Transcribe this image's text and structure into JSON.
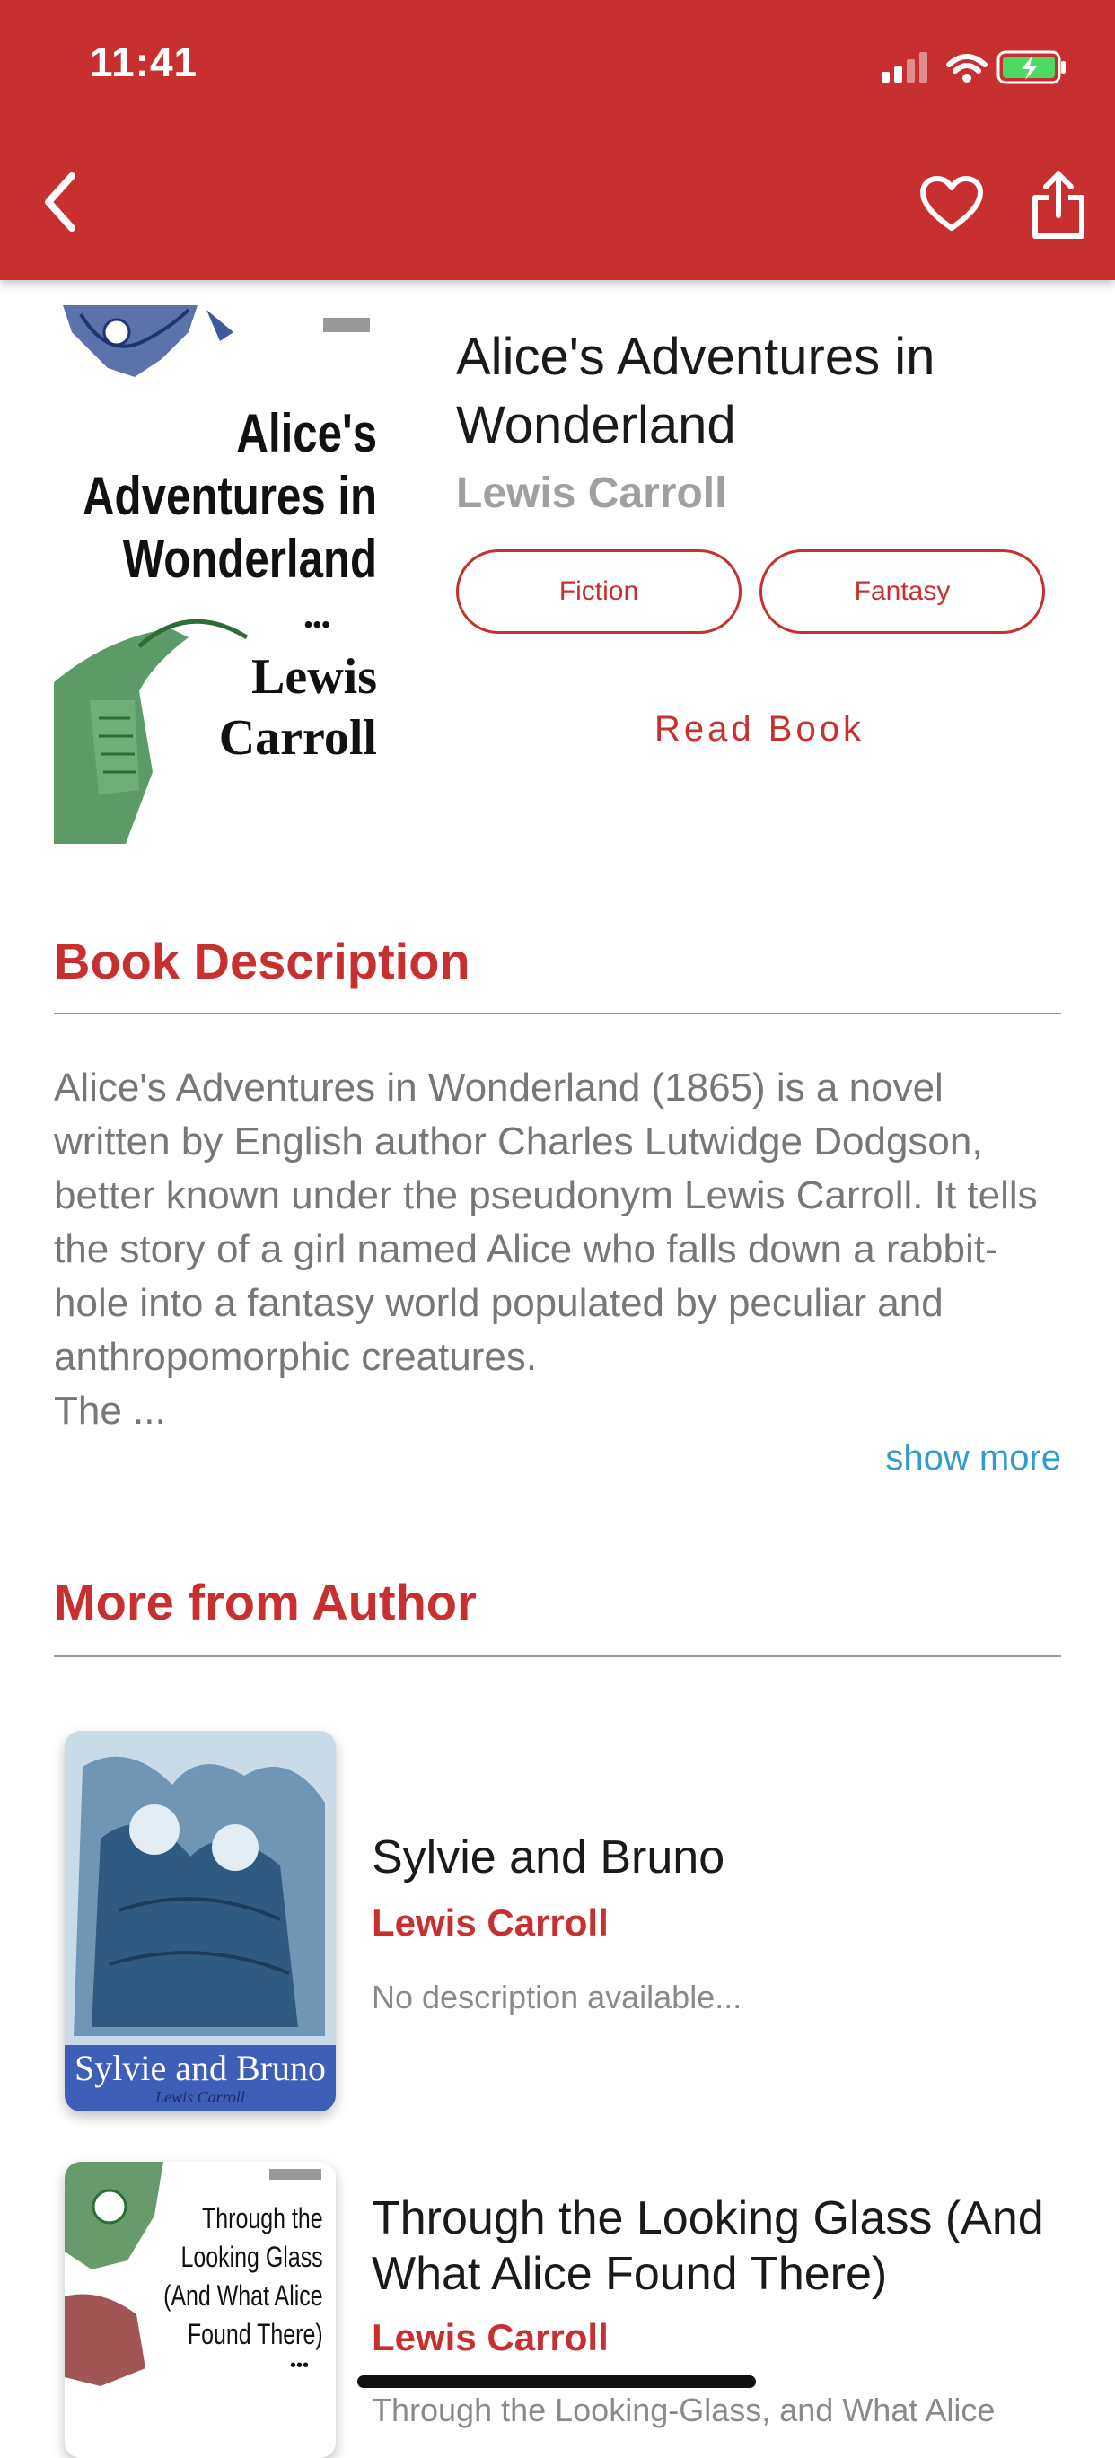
{
  "status_bar": {
    "time": "11:41"
  },
  "nav": {
    "back_icon": "chevron-left-icon",
    "favorite_icon": "heart-icon",
    "share_icon": "share-icon"
  },
  "book": {
    "cover": {
      "title_lines": [
        "Alice's",
        "Adventures in",
        "Wonderland"
      ],
      "dots": "•••",
      "author_lines": [
        "Lewis",
        "Carroll"
      ]
    },
    "title": "Alice's Adventures in Wonderland",
    "author": "Lewis Carroll",
    "genres": [
      "Fiction",
      "Fantasy"
    ],
    "read_label": "Read Book"
  },
  "description_section": {
    "heading": "Book Description",
    "text": "Alice's Adventures in Wonderland (1865) is a novel written by English author Charles Lutwidge Dodgson, better known under the pseudonym Lewis Carroll. It tells the story of a girl named Alice who falls down a rabbit-hole into a fantasy world populated by peculiar and anthropomorphic creatures.\nThe ...",
    "show_more": "show more"
  },
  "more_section": {
    "heading": "More from Author",
    "books": [
      {
        "title": "Sylvie and Bruno",
        "author": "Lewis Carroll",
        "description": "No description available...",
        "cover_title": "Sylvie and Bruno",
        "cover_sub": "Lewis Carroll"
      },
      {
        "title": "Through the Looking Glass (And What Alice Found There)",
        "author": "Lewis Carroll",
        "description": "Through the Looking-Glass, and What Alice",
        "cover_title_lines": [
          "Through the",
          "Looking Glass",
          "(And What Alice",
          "Found There)"
        ],
        "cover_dots": "•••"
      }
    ]
  },
  "colors": {
    "brand": "#c83030",
    "link": "#2f9cd0",
    "muted": "#777777"
  }
}
